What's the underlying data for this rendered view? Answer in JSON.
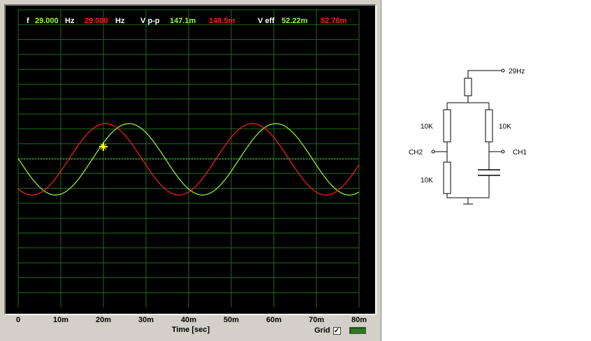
{
  "scope": {
    "readouts": {
      "f_label": "f",
      "f_ch1": "29.000",
      "hz_ch1": "Hz",
      "f_ch2": "29.000",
      "hz_ch2": "Hz",
      "vpp_label": "V p-p",
      "vpp_ch1": "147.1m",
      "vpp_ch2": "148.5m",
      "veff_label": "V eff",
      "veff_ch1": "52.22m",
      "veff_ch2": "52.70m"
    },
    "xaxis": {
      "title": "Time [sec]",
      "ticks": [
        "0",
        "10m",
        "20m",
        "30m",
        "40m",
        "50m",
        "60m",
        "70m",
        "80m"
      ]
    },
    "grid": {
      "label": "Grid",
      "checked": true,
      "check_glyph": "✓"
    },
    "colors": {
      "background": "#000000",
      "grid": "#1f6b1f",
      "ch1_trace": "#99ff33",
      "ch2_trace": "#ff2020",
      "readout_white": "#ffffff",
      "cursor": "#ffff00"
    }
  },
  "chart_data": {
    "type": "line",
    "title": "",
    "xlabel": "Time [sec]",
    "ylabel": "",
    "xlim": [
      0,
      0.08
    ],
    "grid": true,
    "series": [
      {
        "name": "",
        "frequency_hz": 29.0,
        "peak_time_s": 0.026,
        "amplitude_div": 2.4,
        "color": "#99ff33"
      },
      {
        "name": "",
        "frequency_hz": 29.0,
        "peak_time_s": 0.0205,
        "amplitude_div": 2.4,
        "color": "#ff2020"
      }
    ]
  },
  "circuit": {
    "source_label": "29Hz",
    "r_left_top": "10K",
    "r_left_bottom": "10K",
    "r_right_top": "10K",
    "ch2_label": "CH2",
    "ch1_label": "CH1"
  }
}
